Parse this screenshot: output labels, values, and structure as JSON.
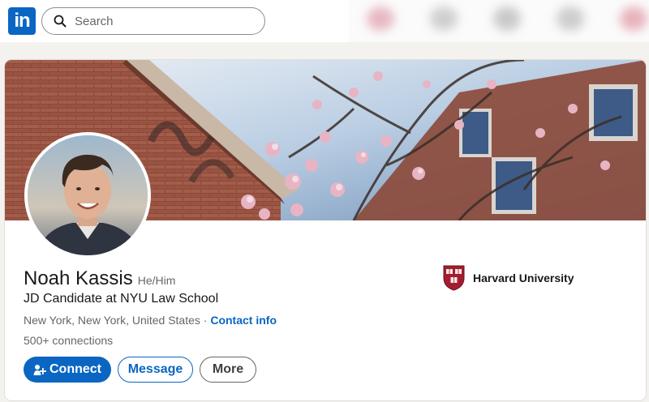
{
  "nav": {
    "logo_text": "in",
    "search_placeholder": "Search"
  },
  "profile": {
    "name": "Noah Kassis",
    "pronouns": "He/Him",
    "headline": "JD Candidate at NYU Law School",
    "location": "New York, New York, United States · ",
    "contact_info": "Contact info",
    "connections": "500+ connections"
  },
  "actions": {
    "connect": "Connect",
    "message": "Message",
    "more": "More"
  },
  "education": {
    "school": "Harvard University"
  },
  "colors": {
    "brand_blue": "#0a66c2",
    "page_background": "#f3f2ef",
    "harvard_crimson": "#a51c30"
  },
  "icons": [
    "search-icon",
    "person-add-icon",
    "harvard-shield-icon"
  ]
}
